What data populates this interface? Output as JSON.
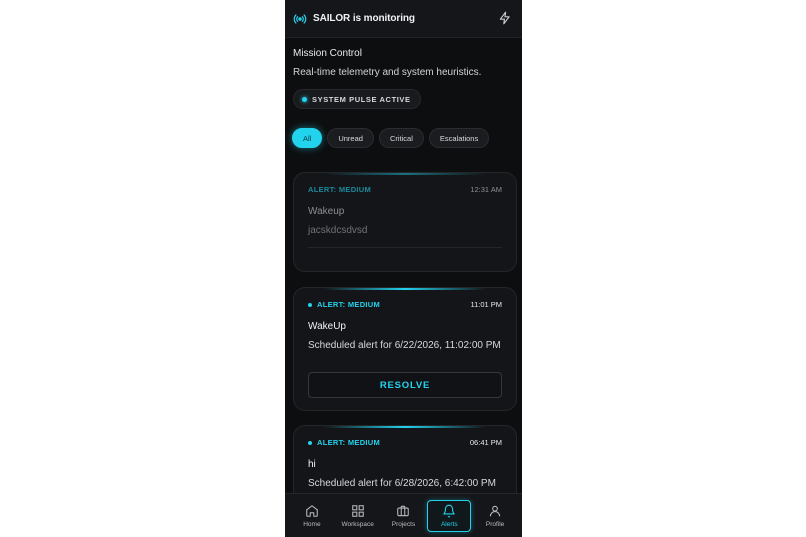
{
  "header": {
    "title": "SAILOR is monitoring"
  },
  "intro": {
    "title": "Mission Control",
    "subtitle": "Real-time telemetry and system heuristics.",
    "pulse_label": "SYSTEM PULSE ACTIVE"
  },
  "filters": [
    {
      "label": "All",
      "active": true
    },
    {
      "label": "Unread",
      "active": false
    },
    {
      "label": "Critical",
      "active": false
    },
    {
      "label": "Escalations",
      "active": false
    }
  ],
  "alerts": [
    {
      "severity": "ALERT: MEDIUM",
      "time": "12:31 AM",
      "title": "Wakeup",
      "description": "jacskdcsdvsd",
      "resolved": true
    },
    {
      "severity": "ALERT: MEDIUM",
      "time": "11:01 PM",
      "title": "WakeUp",
      "description": "Scheduled alert for 6/22/2026, 11:02:00 PM",
      "action": "RESOLVE"
    },
    {
      "severity": "ALERT: MEDIUM",
      "time": "06:41 PM",
      "title": "hi",
      "description": "Scheduled alert for 6/28/2026, 6:42:00 PM"
    }
  ],
  "nav": [
    {
      "label": "Home",
      "icon": "home-icon"
    },
    {
      "label": "Workspace",
      "icon": "grid-icon"
    },
    {
      "label": "Projects",
      "icon": "briefcase-icon"
    },
    {
      "label": "Alerts",
      "icon": "bell-icon",
      "active": true
    },
    {
      "label": "Profile",
      "icon": "user-icon"
    }
  ],
  "colors": {
    "accent": "#22d3ee",
    "background": "#0d0e10",
    "surface": "#141518"
  }
}
